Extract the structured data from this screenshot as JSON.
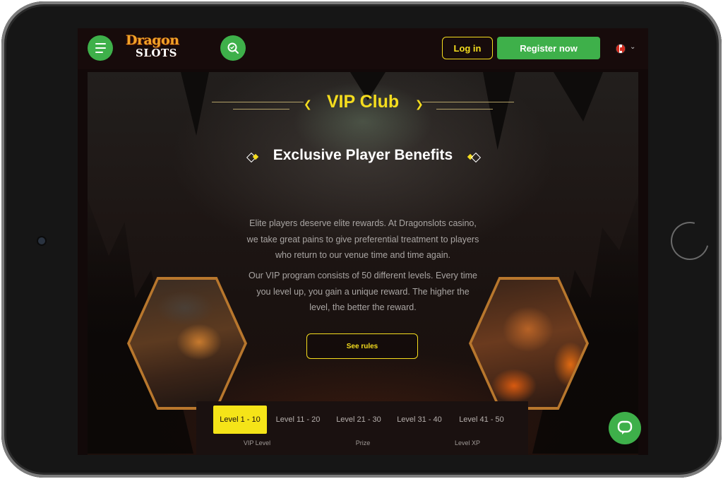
{
  "header": {
    "logo_line1": "Dragon",
    "logo_line2": "SLOTS",
    "login_label": "Log in",
    "register_label": "Register now",
    "language_flag": "canada-flag-icon",
    "colors": {
      "green": "#3eb04a",
      "yellow": "#f5dd1e"
    }
  },
  "hero": {
    "title": "VIP Club",
    "subtitle": "Exclusive Player Benefits",
    "paragraph1": "Elite players deserve elite rewards. At Dragonslots casino, we take great pains to give preferential treatment to players who return to our venue time and time again.",
    "paragraph2": "Our VIP program consists of 50 different levels. Every time you level up, you gain a unique reward. The higher the level, the better the reward.",
    "rules_button": "See rules"
  },
  "levels": {
    "tabs": [
      "Level 1 - 10",
      "Level 11 - 20",
      "Level 21 - 30",
      "Level 31 - 40",
      "Level 41 - 50"
    ],
    "active_index": 0,
    "columns": [
      "VIP Level",
      "Prize",
      "Level XP"
    ]
  }
}
